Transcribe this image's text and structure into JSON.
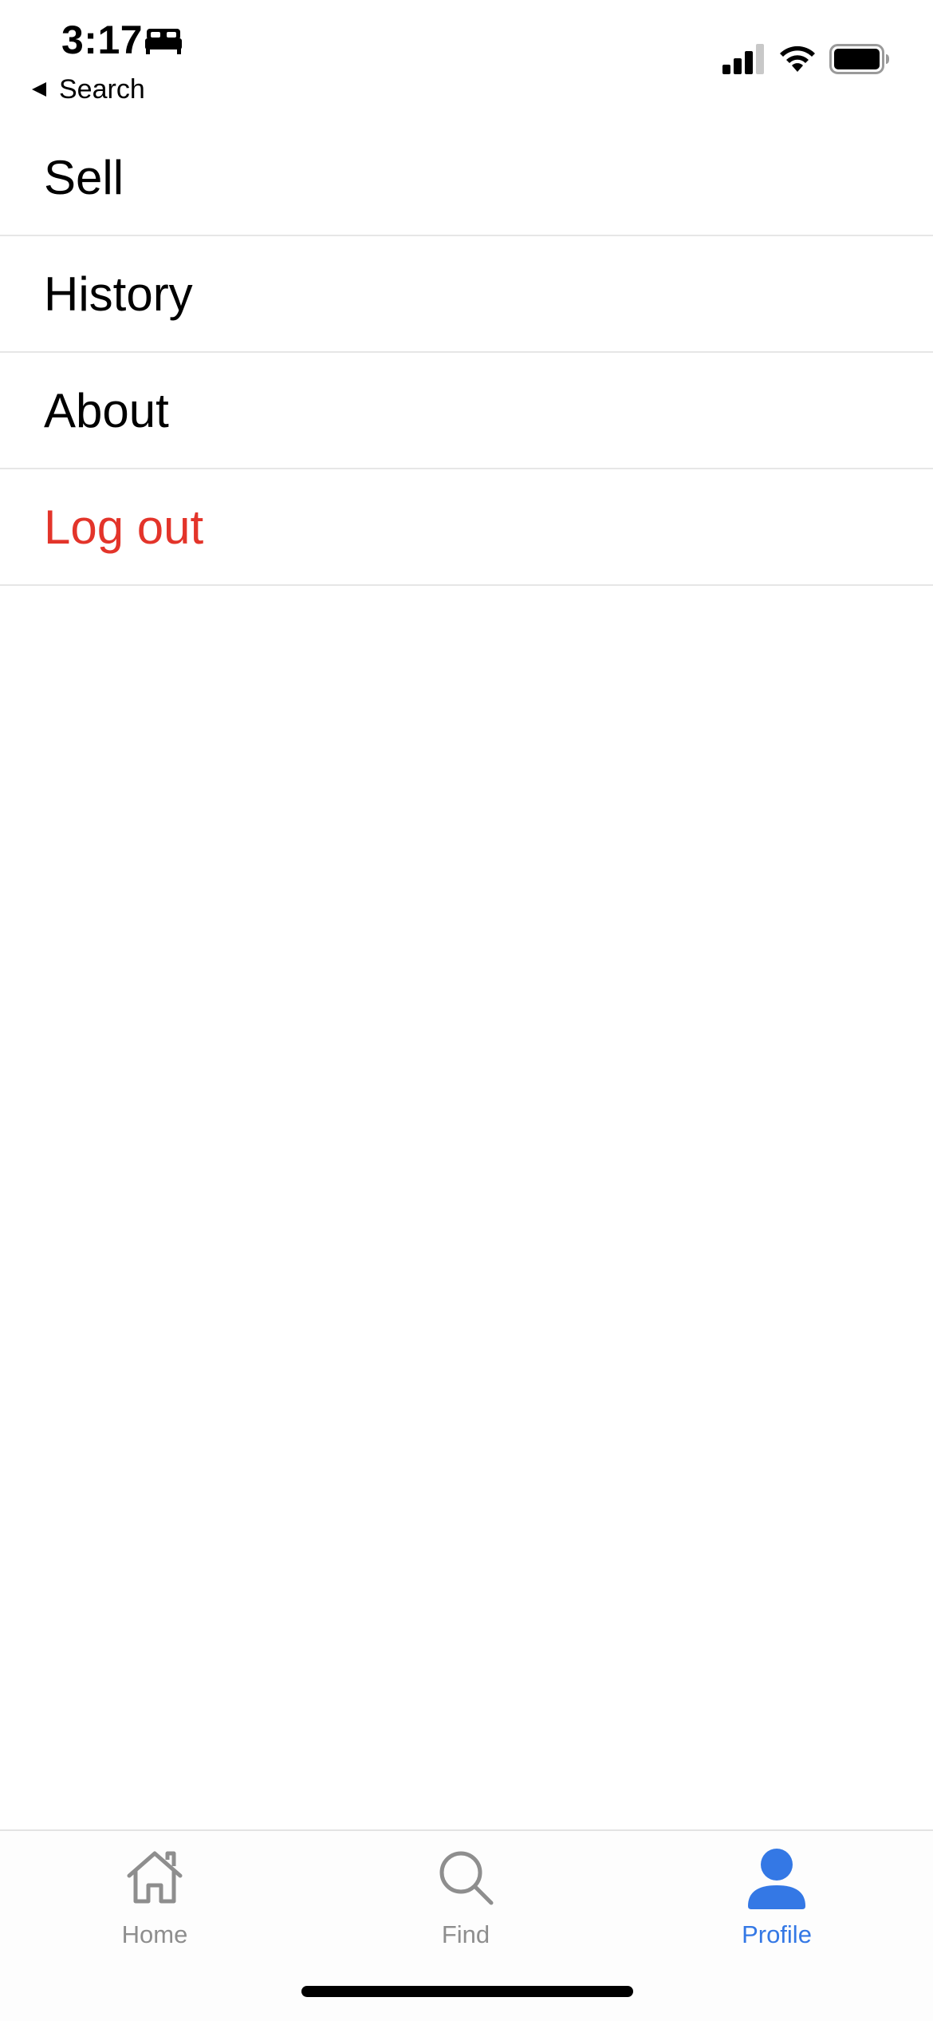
{
  "status_bar": {
    "time": "3:17",
    "back_label": "Search"
  },
  "menu": {
    "items": [
      {
        "label": "Sell"
      },
      {
        "label": "History"
      },
      {
        "label": "About"
      },
      {
        "label": "Log out"
      }
    ]
  },
  "tab_bar": {
    "tabs": [
      {
        "label": "Home",
        "icon": "home-icon"
      },
      {
        "label": "Find",
        "icon": "search-icon"
      },
      {
        "label": "Profile",
        "icon": "profile-icon",
        "selected": true
      }
    ]
  },
  "colors": {
    "accent": "#3478e5",
    "destructive": "#e3342a",
    "inactive_tab": "#8e8e8e"
  }
}
